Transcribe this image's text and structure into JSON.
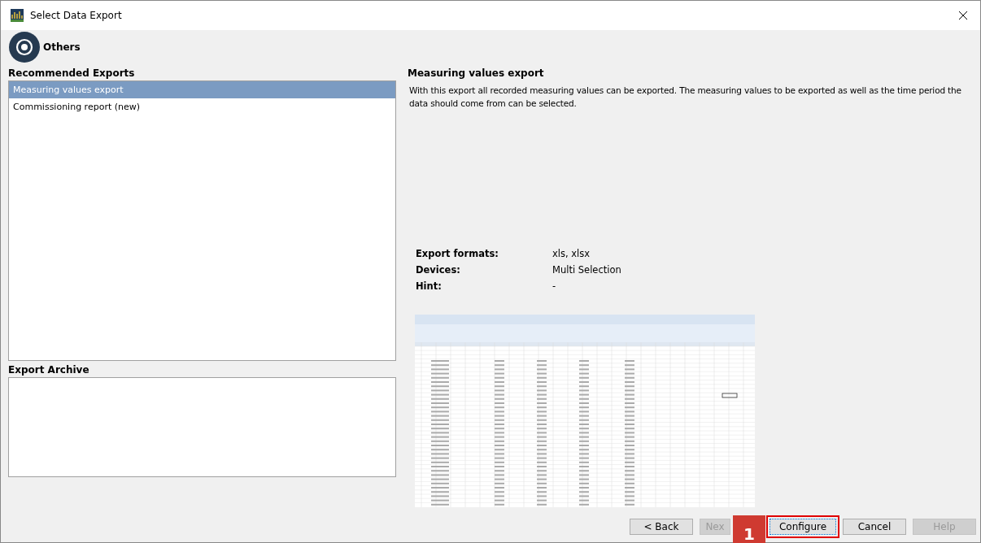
{
  "window": {
    "title": "Select Data Export"
  },
  "category": {
    "title": "Others"
  },
  "recommended_exports": {
    "heading": "Recommended Exports",
    "items": [
      {
        "label": "Measuring values export",
        "selected": true
      },
      {
        "label": "Commissioning report (new)",
        "selected": false
      }
    ]
  },
  "export_archive": {
    "heading": "Export Archive"
  },
  "details": {
    "title": "Measuring values export",
    "description": "With this export all recorded measuring values can be exported. The measuring values to be exported as well as the time period the data should come from can be selected.",
    "properties": [
      {
        "label": "Export formats:",
        "value": "xls, xlsx"
      },
      {
        "label": "Devices:",
        "value": "Multi Selection"
      },
      {
        "label": "Hint:",
        "value": "-"
      }
    ]
  },
  "buttons": [
    {
      "label": "< Back",
      "disabled": false,
      "highlighted": false,
      "partly_covered": false
    },
    {
      "label": "Nex",
      "disabled": true,
      "highlighted": false,
      "partly_covered": true
    },
    {
      "label": "Configure",
      "disabled": false,
      "highlighted": true,
      "partly_covered": false
    },
    {
      "label": "Cancel",
      "disabled": false,
      "highlighted": false,
      "partly_covered": false
    },
    {
      "label": "Help",
      "disabled": true,
      "highlighted": false,
      "partly_covered": false
    }
  ],
  "step_badge": {
    "label": "1"
  }
}
